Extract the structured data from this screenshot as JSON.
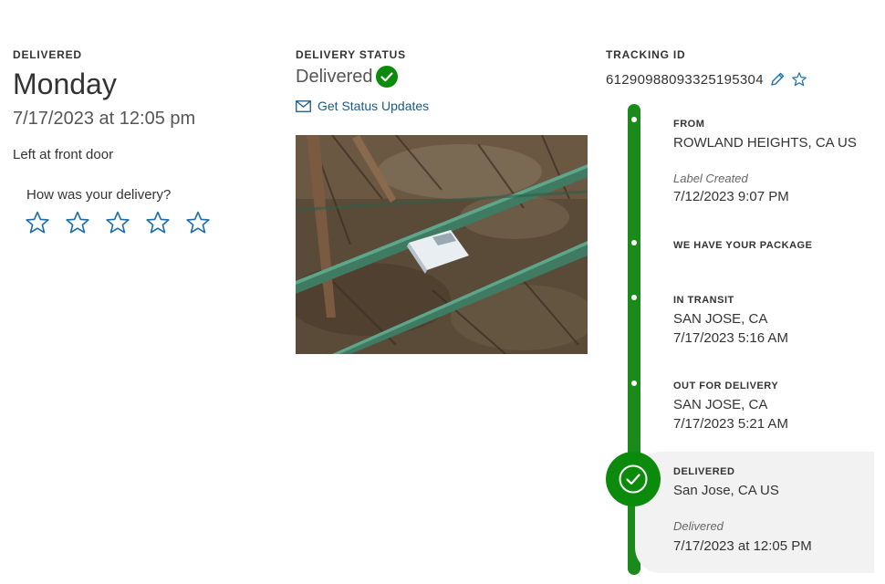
{
  "summary": {
    "eyebrow": "DELIVERED",
    "day": "Monday",
    "datetime": "7/17/2023 at 12:05 pm",
    "left_at": "Left at front door",
    "rating_question": "How was your delivery?",
    "star_count": 5,
    "star_icon": "star-outline-icon"
  },
  "status": {
    "eyebrow": "DELIVERY STATUS",
    "text": "Delivered",
    "badge_icon": "check-circle-icon",
    "updates_icon": "envelope-icon",
    "updates_label": "Get Status Updates"
  },
  "tracking": {
    "eyebrow": "TRACKING ID",
    "number": "61290988093325195304",
    "edit_icon": "pencil-icon",
    "favorite_icon": "star-outline-icon"
  },
  "timeline": {
    "events": [
      {
        "label": "FROM",
        "location": "ROWLAND HEIGHTS, CA US",
        "note": "Label Created",
        "time": "7/12/2023 9:07 PM"
      },
      {
        "label": "WE HAVE YOUR PACKAGE"
      },
      {
        "label": "IN TRANSIT",
        "location": "SAN JOSE, CA",
        "time": "7/17/2023 5:16 AM"
      },
      {
        "label": "OUT FOR DELIVERY",
        "location": "SAN JOSE, CA",
        "time": "7/17/2023 5:21 AM"
      },
      {
        "label": "DELIVERED",
        "location": "San Jose, CA US",
        "note": "Delivered",
        "time": "7/17/2023 at 12:05 PM"
      }
    ]
  },
  "colors": {
    "timeline_green": "#1a8a1a",
    "link_blue": "#1a5a8a",
    "star_outline": "#1a6fa8",
    "delivered_panel": "#f2f2f2"
  }
}
